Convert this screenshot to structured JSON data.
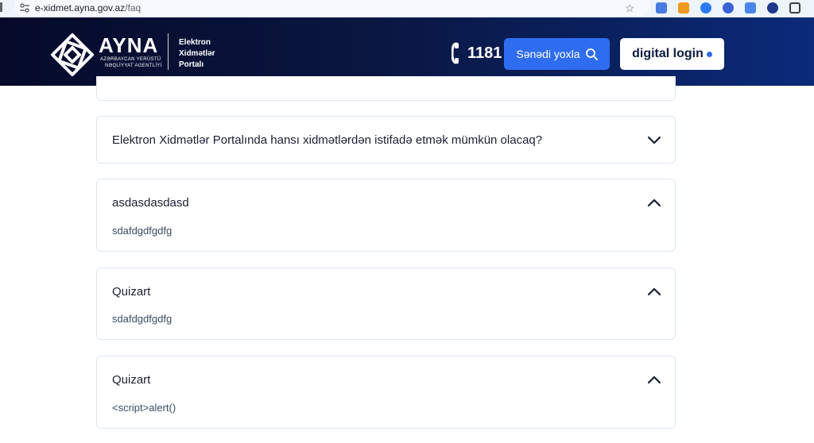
{
  "browser": {
    "url_host": "e-xidmet.ayna.gov.az",
    "url_path": "/faq",
    "icons": [
      "tune-icon",
      "star-icon",
      "translate-icon",
      "rss-icon",
      "check-icon",
      "link-icon",
      "tag-icon",
      "settings-icon",
      "puzzle-icon"
    ]
  },
  "header": {
    "brand": "AYNA",
    "brand_sub1": "AZƏRBAYCAN YERÜSTÜ",
    "brand_sub2": "NƏQLİYYAT AGENTLİYİ",
    "portal_lines": [
      "Elektron",
      "Xidmətlər",
      "Portalı"
    ],
    "phone": "1181",
    "verify_label": "Sənədi yoxla",
    "login_label": "digital login",
    "colors": {
      "bg_dark": "#050a2a",
      "bg_blue": "#0b2a7a",
      "accent": "#2f6df0"
    }
  },
  "faq": [
    {
      "question": "Elektron Xidmətlər Portalında hansı xidmətlərdən istifadə etmək mümkün olacaq?",
      "answer": "",
      "expanded": false
    },
    {
      "question": "asdasdasdasd",
      "answer": "sdafdgdfgdfg",
      "expanded": true
    },
    {
      "question": "Quizart",
      "answer": "sdafdgdfgdfg",
      "expanded": true
    },
    {
      "question": "Quizart",
      "answer": "<script>alert()",
      "expanded": true
    }
  ]
}
